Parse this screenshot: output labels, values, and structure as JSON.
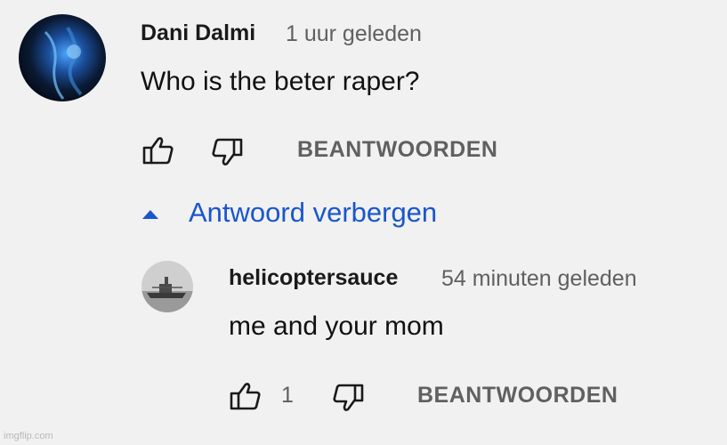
{
  "comment": {
    "author": "Dani Dalmi",
    "time": "1 uur geleden",
    "text": "Who is the beter raper?",
    "reply_label": "BEANTWOORDEN"
  },
  "replies_toggle": {
    "label": "Antwoord verbergen"
  },
  "reply": {
    "author": "helicoptersauce",
    "time": "54 minuten geleden",
    "text": "me and your mom",
    "like_count": "1",
    "reply_label": "BEANTWOORDEN"
  },
  "watermark": "imgflip.com",
  "colors": {
    "background": "#f1f1f1",
    "link_blue": "#1a56cc",
    "secondary_text": "#606060"
  }
}
